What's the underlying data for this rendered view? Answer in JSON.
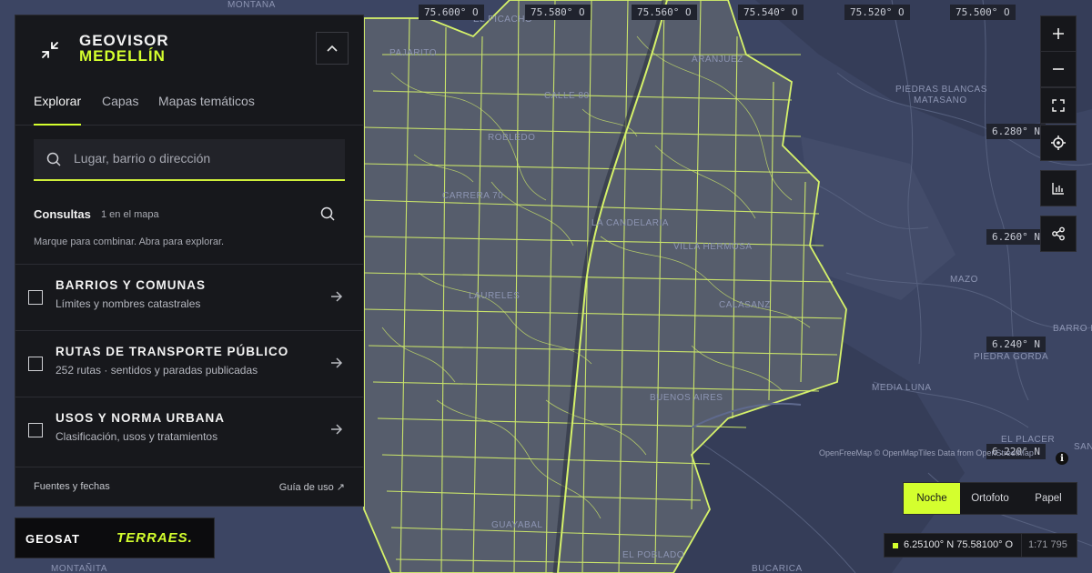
{
  "app": {
    "title_line1": "GEOVISOR",
    "title_line2": "MEDELLÍN",
    "accent_color": "#d4ff2e"
  },
  "tabs": [
    {
      "label": "Explorar",
      "active": true
    },
    {
      "label": "Capas",
      "active": false
    },
    {
      "label": "Mapas temáticos",
      "active": false
    }
  ],
  "search": {
    "placeholder": "Lugar, barrio o dirección",
    "value": ""
  },
  "consultas": {
    "title": "Consultas",
    "count": "1 en el mapa",
    "hint": "Marque para combinar. Abra para explorar."
  },
  "layers": [
    {
      "title": "BARRIOS Y COMUNAS",
      "subtitle": "Límites y nombres catastrales",
      "checked": false
    },
    {
      "title": "RUTAS DE TRANSPORTE PÚBLICO",
      "subtitle": "252 rutas · sentidos y paradas publicadas",
      "checked": false
    },
    {
      "title": "USOS Y NORMA URBANA",
      "subtitle": "Clasificación, usos y tratamientos",
      "checked": false
    }
  ],
  "footer": {
    "sources": "Fuentes y fechas",
    "guide": "Guía de uso ↗"
  },
  "brands": {
    "left": "GEOSAT",
    "right": "TERRAES."
  },
  "map_controls": [
    "zoom-in",
    "zoom-out",
    "fullscreen",
    "locate",
    "chart",
    "share"
  ],
  "basemaps": [
    {
      "label": "Noche",
      "active": true
    },
    {
      "label": "Ortofoto",
      "active": false
    },
    {
      "label": "Papel",
      "active": false
    }
  ],
  "coordinates": {
    "readout": "6.25100° N 75.58100° O",
    "scale": "1:71 795"
  },
  "grid_longitudes": [
    "75.600° O",
    "75.580° O",
    "75.560° O",
    "75.540° O",
    "75.520° O",
    "75.500° O"
  ],
  "grid_latitudes": [
    "6.280° N",
    "6.260° N",
    "6.240° N",
    "6.220° N"
  ],
  "attribution": "OpenFreeMap © OpenMapTiles Data from OpenStreetMap",
  "place_labels": [
    "MONTAÑA",
    "EL PICACHO",
    "PAJARITO",
    "ROBLEDO",
    "LAURELES",
    "VILLA HERMOSA",
    "CALASANZ",
    "BUENOS AIRES",
    "GUAYABAL",
    "EL POBLADO",
    "PIEDRAS BLANCAS",
    "MATASANO",
    "MAZO",
    "PIEDRA GORDA",
    "MEDIA LUNA",
    "EL PLACER",
    "BARRO BL",
    "MONTAÑITA",
    "BUCARICA",
    "SANTA ELENA",
    "CALLE 80",
    "CARRERA 70",
    "LA CANDELARIA",
    "ARANJUEZ"
  ],
  "colors": {
    "map_bg": "#3c4563",
    "urban_fill": "#565d6c",
    "boundary_stroke": "#d6f26a",
    "panel_bg": "#17181c"
  }
}
